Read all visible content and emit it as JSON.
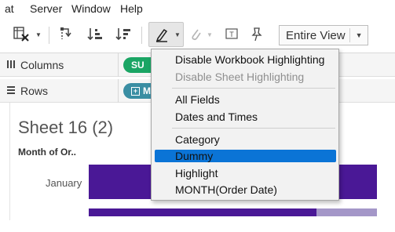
{
  "menubar": {
    "items": [
      "at",
      "Server",
      "Window",
      "Help"
    ]
  },
  "toolbar": {
    "icons": [
      "clear-sheet-icon",
      "swap-rows-columns-icon",
      "sort-ascending-icon",
      "sort-descending-icon",
      "highlight-pencil-icon",
      "paperclip-icon",
      "text-label-icon",
      "pin-icon"
    ],
    "view_select": "Entire View"
  },
  "shelves": {
    "columns_label": "Columns",
    "columns_pill": "SU",
    "rows_label": "Rows",
    "rows_pill": "M",
    "columns_pill_color": "#1aa564",
    "rows_pill_color": "#3a8ea3"
  },
  "sheet": {
    "title": "Sheet 16 (2)",
    "row_header": "Month of Or..",
    "row_label": "January",
    "bar_color_dark": "#4a1896",
    "bar_color_light": "#a497c8"
  },
  "dropdown": {
    "items": [
      {
        "label": "Disable Workbook Highlighting",
        "disabled": false
      },
      {
        "label": "Disable Sheet Highlighting",
        "disabled": true
      },
      {
        "label": "All Fields",
        "disabled": false
      },
      {
        "label": "Dates and Times",
        "disabled": false
      },
      {
        "label": "Category",
        "disabled": false
      },
      {
        "label": "Dummy",
        "disabled": false,
        "selected": true
      },
      {
        "label": "Highlight",
        "disabled": false
      },
      {
        "label": "MONTH(Order Date)",
        "disabled": false
      }
    ],
    "highlight_color": "#0b74d6"
  }
}
